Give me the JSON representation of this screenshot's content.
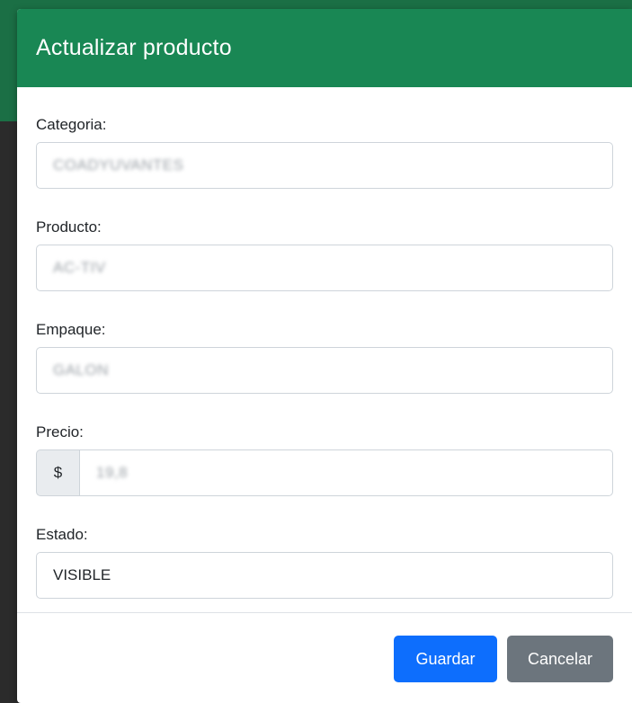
{
  "modal": {
    "title": "Actualizar producto"
  },
  "form": {
    "categoria": {
      "label": "Categoria:",
      "value": "COADYUVANTES"
    },
    "producto": {
      "label": "Producto:",
      "value": "AC-TIV"
    },
    "empaque": {
      "label": "Empaque:",
      "value": "GALON"
    },
    "precio": {
      "label": "Precio:",
      "prefix": "$",
      "value": "19,8"
    },
    "estado": {
      "label": "Estado:",
      "value": "VISIBLE"
    }
  },
  "footer": {
    "save_label": "Guardar",
    "cancel_label": "Cancelar"
  },
  "colors": {
    "header_bg": "#198754",
    "primary": "#0d6efd",
    "secondary": "#6c757d"
  }
}
